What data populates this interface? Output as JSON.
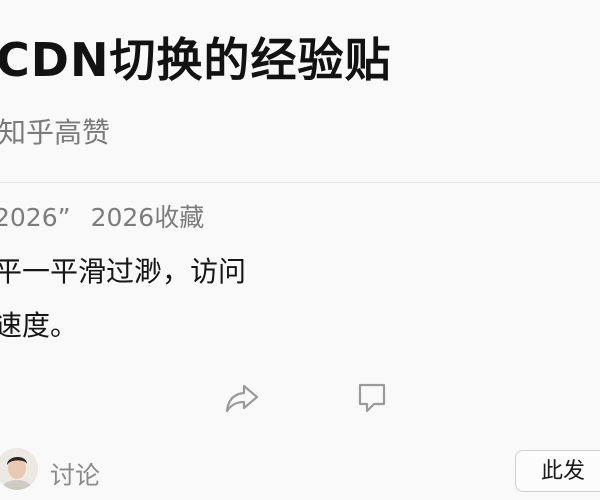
{
  "post": {
    "title": "CDN切换的经验贴",
    "subtitle": "知乎高赞",
    "meta_quote": "2026”",
    "meta_collection": "2026收藏",
    "body_lines": [
      "平一平滑过渺，访问",
      "速度。"
    ]
  },
  "actions": {
    "share_icon": "share-arrow-icon",
    "comment_icon": "comment-icon"
  },
  "footer": {
    "discuss_label": "讨论",
    "post_button_label": "此发"
  }
}
